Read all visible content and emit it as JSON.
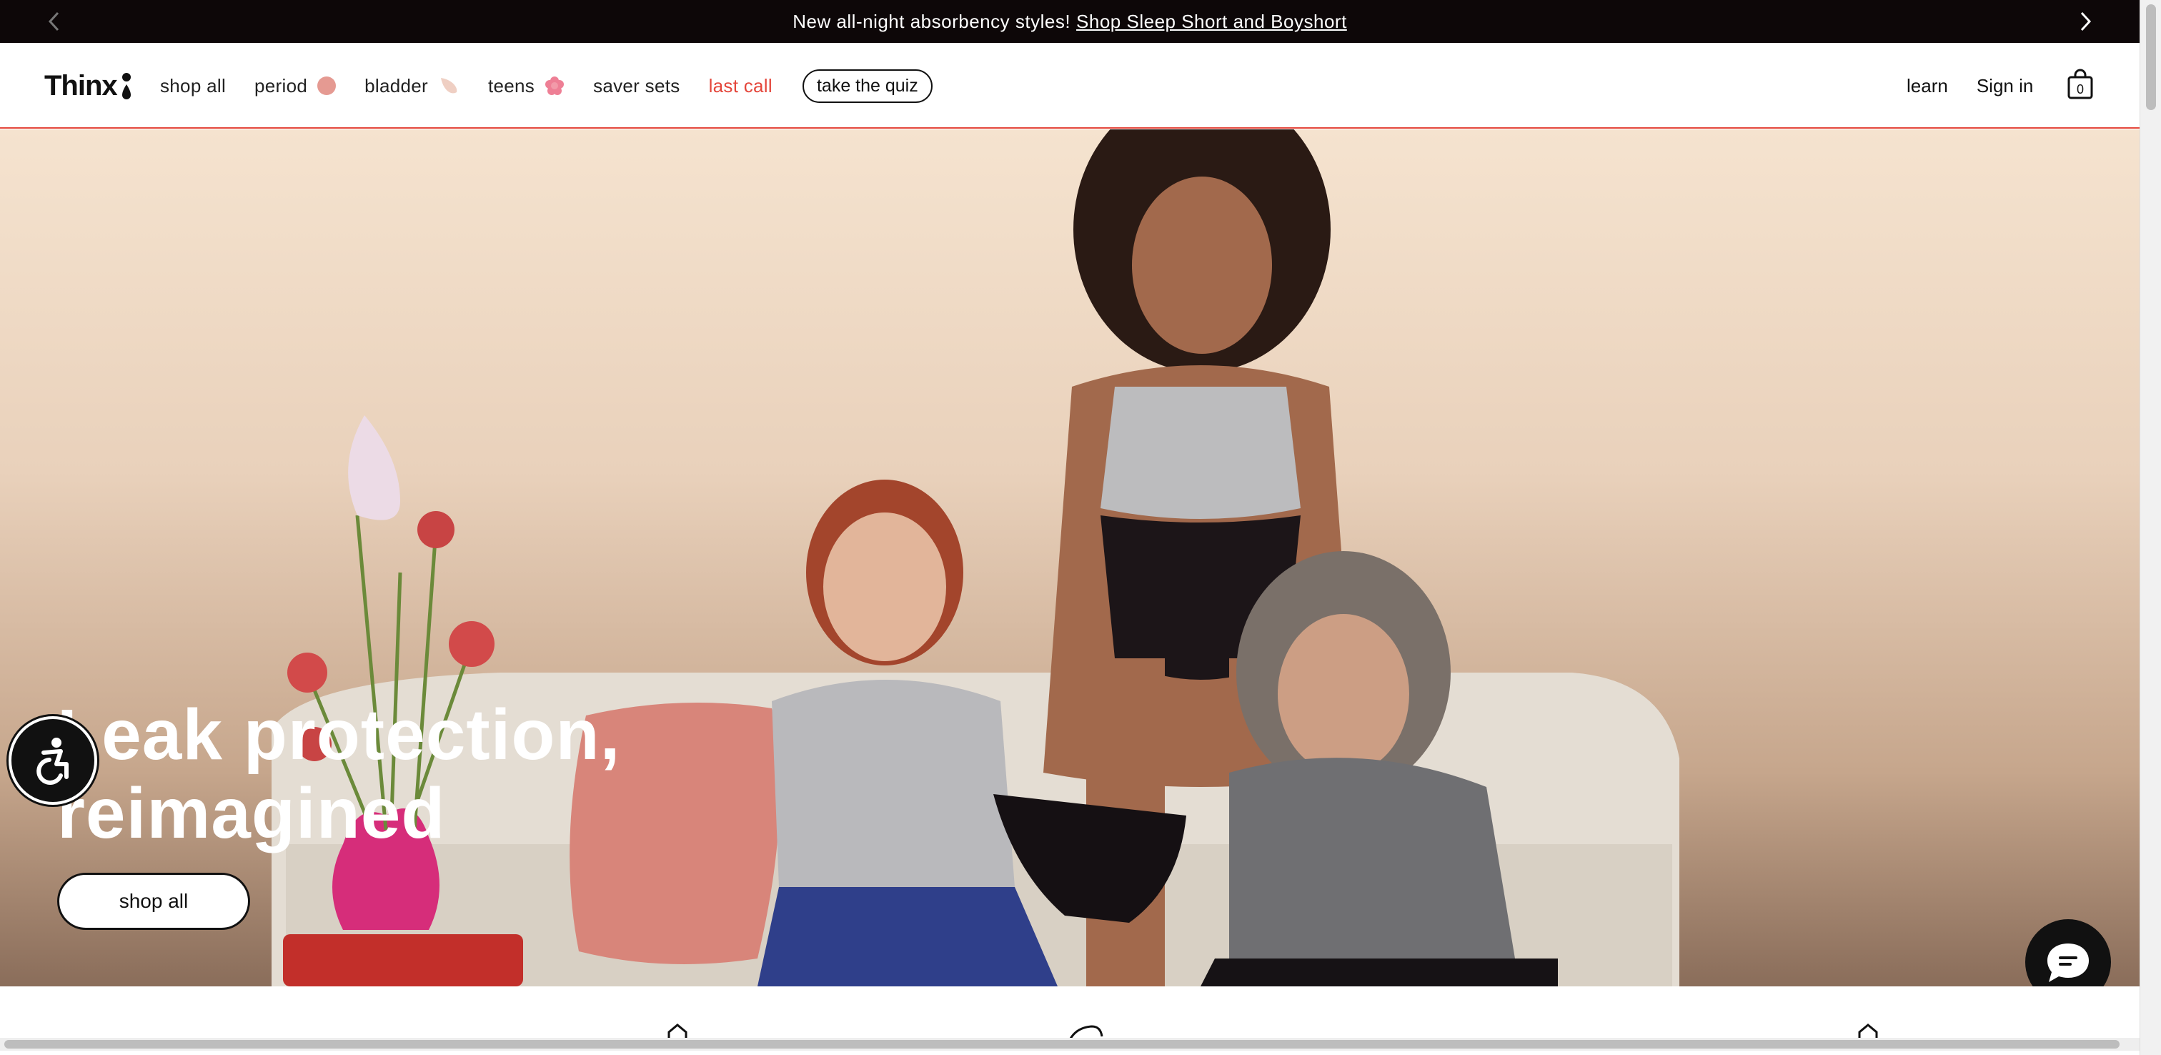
{
  "announcement": {
    "text": "New all-night absorbency styles!",
    "link": "Shop Sleep Short and Boyshort"
  },
  "header": {
    "logo": "Thinx",
    "nav": [
      {
        "label": "shop all"
      },
      {
        "label": "period",
        "dot_color": "#e59a92"
      },
      {
        "label": "bladder",
        "dot_color": "#f0d2c6"
      },
      {
        "label": "teens",
        "dot_color": "#ee7f95"
      },
      {
        "label": "saver sets"
      },
      {
        "label": "last call",
        "color": "#e4473c"
      }
    ],
    "quiz_label": "take the quiz",
    "learn_label": "learn",
    "signin_label": "Sign in",
    "cart_count": "0"
  },
  "hero": {
    "title_line1": "Leak protection,",
    "title_line2": "reimagined",
    "cta_label": "shop all"
  },
  "colors": {
    "accent": "#e4473c",
    "announcement_bg": "#0d0708"
  }
}
